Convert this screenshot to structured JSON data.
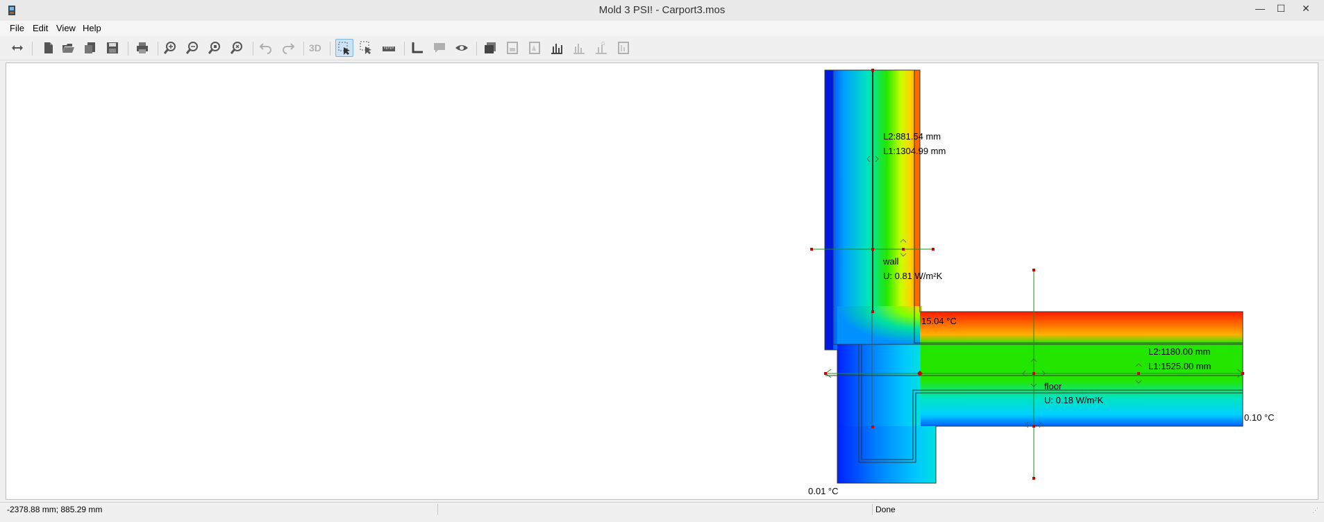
{
  "window": {
    "title": "Mold 3 PSI! - Carport3.mos",
    "minimize_glyph": "—",
    "maximize_glyph": "☐",
    "close_glyph": "✕"
  },
  "menu": {
    "items": [
      "File",
      "Edit",
      "View",
      "Help"
    ]
  },
  "toolbar": {
    "three_d_label": "3D",
    "tools": [
      "swap-horizontal-icon",
      "new-file-icon",
      "open-file-icon",
      "import-icon",
      "save-icon",
      "print-icon",
      "zoom-in-icon",
      "zoom-out-icon",
      "zoom-fit-icon",
      "zoom-reset-icon",
      "undo-icon",
      "redo-icon",
      "select-pointer-icon",
      "select-region-icon",
      "ruler-icon",
      "angle-icon",
      "comment-icon",
      "eye-icon",
      "layers-icon",
      "chart-icon"
    ]
  },
  "drawing": {
    "wall_label": "wall",
    "wall_u": "U: 0.81 W/m²K",
    "wall_l2": "L2:881.54 mm",
    "wall_l1": "L1:1304.99 mm",
    "floor_label": "floor",
    "floor_u": "U: 0.18 W/m²K",
    "floor_l2": "L2:1180.00 mm",
    "floor_l1": "L1:1525.00 mm",
    "temp_inside": "15.04 °C",
    "temp_right": "0.10 °C",
    "temp_bottom": "0.01 °C",
    "colors": {
      "hot": "#ff1a00",
      "warm": "#ffd400",
      "mid": "#23e600",
      "cool": "#00e5ff",
      "cold": "#0022ff"
    }
  },
  "status": {
    "coords": "-2378.88 mm; 885.29 mm",
    "state": "Done"
  }
}
